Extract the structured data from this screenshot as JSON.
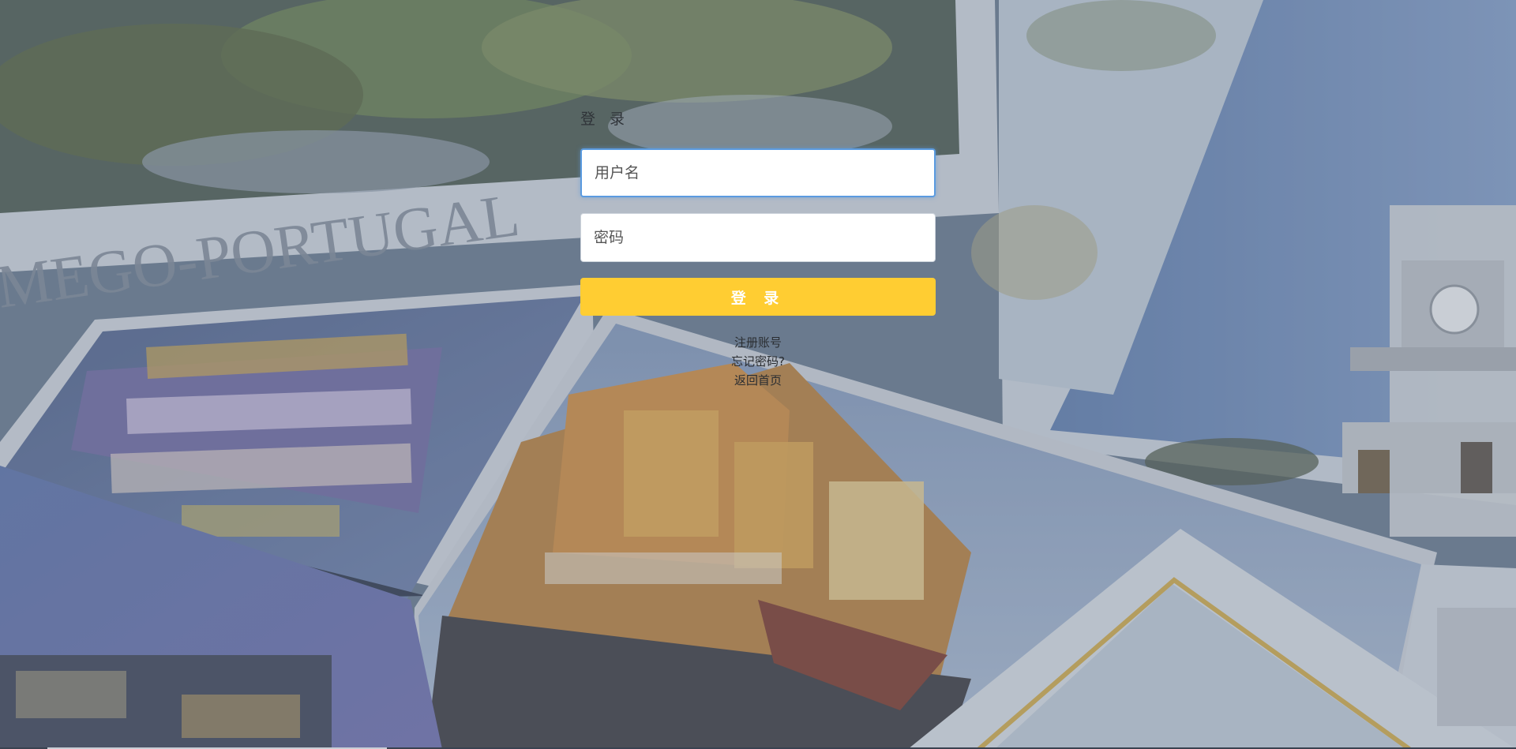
{
  "login": {
    "title": "登 录",
    "username_placeholder": "用户名",
    "password_placeholder": "密码",
    "submit_label": "登 录"
  },
  "links": {
    "register": "注册账号",
    "forgot": "忘记密码?",
    "home": "返回首页"
  },
  "colors": {
    "button": "#ffcd32",
    "focus_border": "#5b9be0"
  },
  "background": {
    "postcard_text": "MEGO-PORTUGAL"
  }
}
